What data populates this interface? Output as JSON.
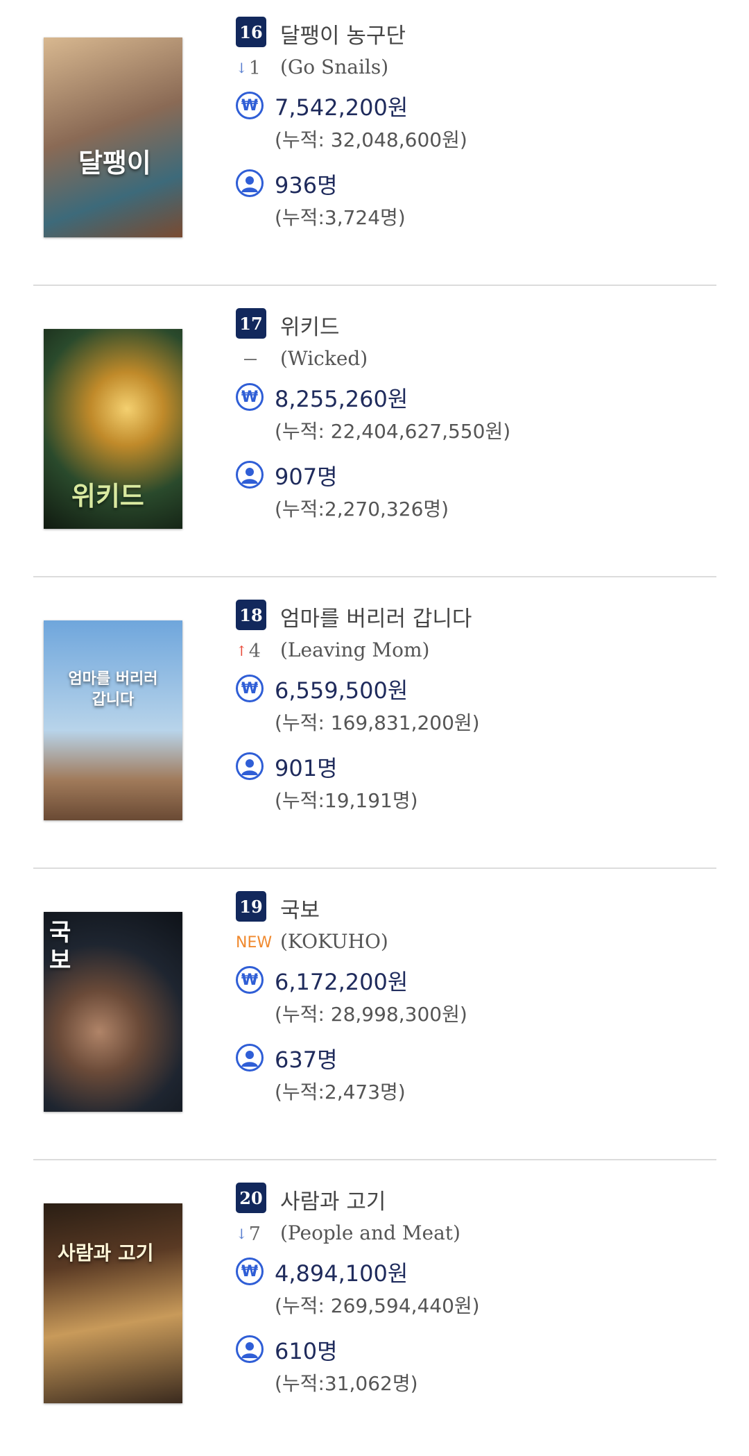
{
  "items": [
    {
      "rank": "16",
      "title": "달팽이 농구단",
      "change": {
        "kind": "down",
        "arrow": "↓",
        "value": "1"
      },
      "original_title": "(Go Snails)",
      "sales": "7,542,200원",
      "sales_cum": "(누적: 32,048,600원)",
      "audience": "936명",
      "audience_cum": "(누적:3,724명)",
      "poster": {
        "text": "달팽이",
        "colors": [
          "#c9a27a",
          "#8a6a55",
          "#3d6a7a"
        ]
      }
    },
    {
      "rank": "17",
      "title": "위키드",
      "change": {
        "kind": "same",
        "arrow": "",
        "value": ""
      },
      "original_title": "(Wicked)",
      "sales": "8,255,260원",
      "sales_cum": "(누적: 22,404,627,550원)",
      "audience": "907명",
      "audience_cum": "(누적:2,270,326명)",
      "poster": {
        "text": "위키드",
        "colors": [
          "#1d2a1a",
          "#e6b94a",
          "#2a4a2c"
        ]
      }
    },
    {
      "rank": "18",
      "title": "엄마를 버리러 갑니다",
      "change": {
        "kind": "up",
        "arrow": "↑",
        "value": "4"
      },
      "original_title": "(Leaving Mom)",
      "sales": "6,559,500원",
      "sales_cum": "(누적: 169,831,200원)",
      "audience": "901명",
      "audience_cum": "(누적:19,191명)",
      "poster": {
        "text": "엄마를 버리러 갑니다",
        "colors": [
          "#7fb2e0",
          "#b8d4ea",
          "#a07a5a"
        ]
      }
    },
    {
      "rank": "19",
      "title": "국보",
      "change": {
        "kind": "new",
        "arrow": "",
        "value": "NEW"
      },
      "original_title": "(KOKUHO)",
      "sales": "6,172,200원",
      "sales_cum": "(누적: 28,998,300원)",
      "audience": "637명",
      "audience_cum": "(누적:2,473명)",
      "poster": {
        "text": "국보",
        "colors": [
          "#141a22",
          "#7a5a44",
          "#1e2530"
        ]
      }
    },
    {
      "rank": "20",
      "title": "사람과 고기",
      "change": {
        "kind": "down",
        "arrow": "↓",
        "value": "7"
      },
      "original_title": "(People and Meat)",
      "sales": "4,894,100원",
      "sales_cum": "(누적: 269,594,440원)",
      "audience": "610명",
      "audience_cum": "(누적:31,062명)",
      "poster": {
        "text": "사람과 고기",
        "colors": [
          "#3a2a1e",
          "#c89a5a",
          "#5a3a24"
        ]
      }
    }
  ],
  "icons": {
    "sales": "won-icon",
    "audience": "user-icon"
  },
  "colors": {
    "rank_bg": "#12285c",
    "accent": "#2f5ed6",
    "new": "#f0892e",
    "up": "#e84b3a",
    "down": "#5a7fd0"
  }
}
